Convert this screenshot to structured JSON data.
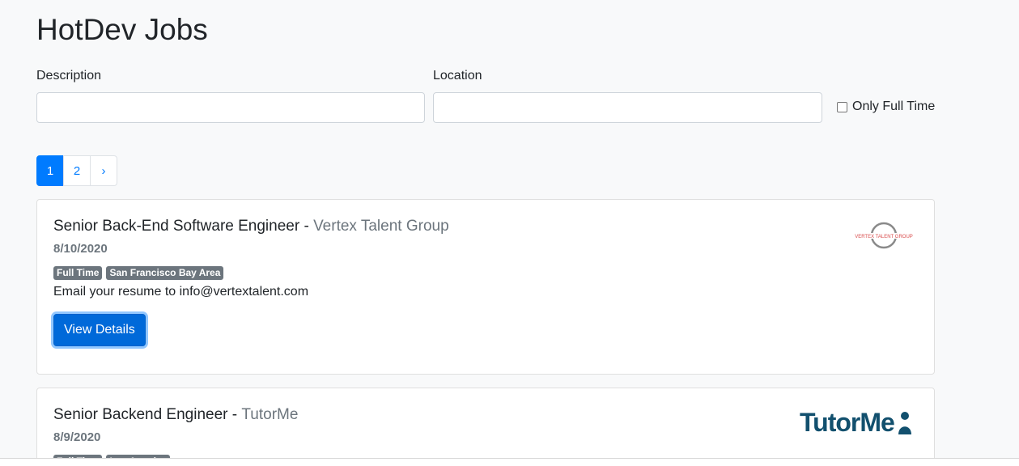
{
  "app": {
    "title": "HotDev Jobs"
  },
  "search": {
    "description_label": "Description",
    "description_value": "",
    "location_label": "Location",
    "location_value": "",
    "full_time_label": "Only Full Time",
    "full_time_checked": false
  },
  "pagination": {
    "pages": [
      "1",
      "2"
    ],
    "next": "›",
    "current": "1"
  },
  "jobs": [
    {
      "title": "Senior Back-End Software Engineer",
      "separator": " - ",
      "company": "Vertex Talent Group",
      "date": "8/10/2020",
      "type": "Full Time",
      "location": "San Francisco Bay Area",
      "description": "Email your resume to info@vertextalent.com",
      "button": "View Details",
      "logo": "VERTEX TALENT GROUP"
    },
    {
      "title": "Senior Backend Engineer",
      "separator": " - ",
      "company": "TutorMe",
      "date": "8/9/2020",
      "type": "Full Time",
      "location": "Los Angeles",
      "logo": "TutorMe"
    }
  ],
  "colors": {
    "primary": "#007bff",
    "badge": "#6c757d",
    "tutorme": "#12506e"
  }
}
